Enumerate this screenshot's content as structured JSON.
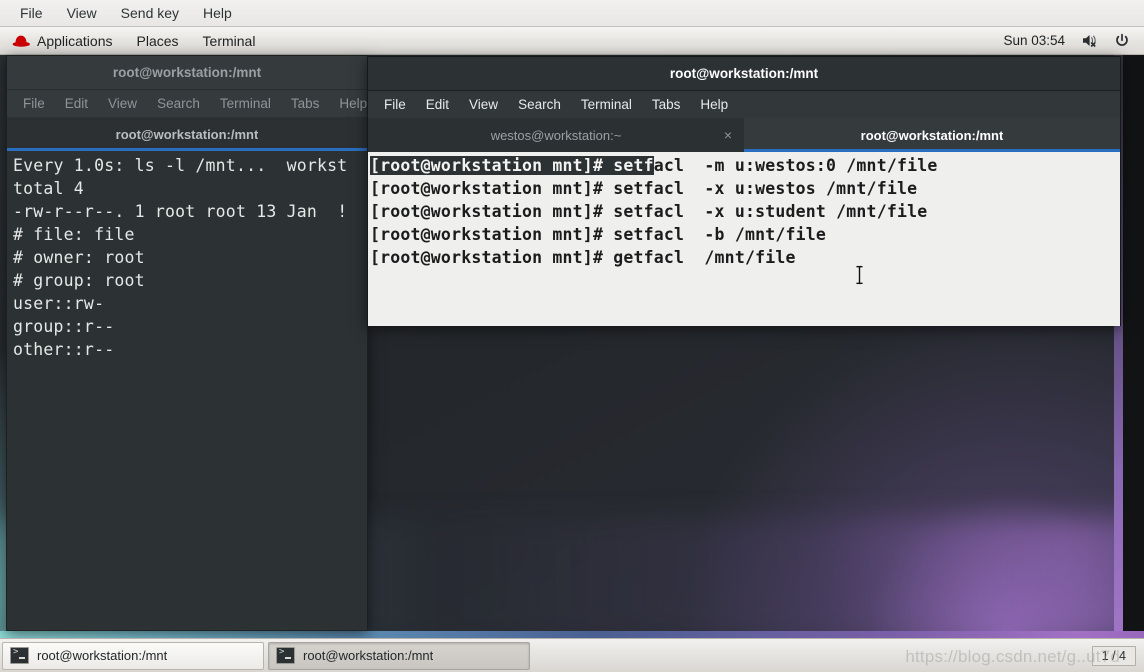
{
  "vm_menu": {
    "items": [
      "File",
      "View",
      "Send key",
      "Help"
    ]
  },
  "gnome_panel": {
    "logo": "redhat-icon",
    "items": [
      "Applications",
      "Places",
      "Terminal"
    ],
    "clock": "Sun 03:54",
    "volume_icon": "volume-muted-icon",
    "power_icon": "power-icon"
  },
  "background_window": {
    "title": "root@workstation:/mnt",
    "menu": [
      "File",
      "Edit",
      "View",
      "Search",
      "Terminal",
      "Tabs",
      "Help"
    ],
    "tabs": [
      {
        "label": "root@workstation:/mnt",
        "active": true
      }
    ],
    "lines": [
      "Every 1.0s: ls -l /mnt...  workst",
      "",
      "total 4",
      "-rw-r--r--. 1 root root 13 Jan  !",
      "# file: file",
      "# owner: root",
      "# group: root",
      "user::rw-",
      "group::r--",
      "other::r--"
    ]
  },
  "foreground_window": {
    "title": "root@workstation:/mnt",
    "menu": [
      "File",
      "Edit",
      "View",
      "Search",
      "Terminal",
      "Tabs",
      "Help"
    ],
    "tabs": [
      {
        "label": "westos@workstation:~",
        "active": false,
        "close": "×"
      },
      {
        "label": "root@workstation:/mnt",
        "active": true
      }
    ],
    "lines": [
      {
        "selected": "[root@workstation mnt]# setf",
        "rest": "acl  -m u:westos:0 /mnt/file"
      },
      {
        "selected": "",
        "rest": "[root@workstation mnt]# setfacl  -x u:westos /mnt/file"
      },
      {
        "selected": "",
        "rest": "[root@workstation mnt]# setfacl  -x u:student /mnt/file"
      },
      {
        "selected": "",
        "rest": "[root@workstation mnt]# setfacl  -b /mnt/file"
      },
      {
        "selected": "",
        "rest": "[root@workstation mnt]# getfacl  /mnt/file"
      }
    ]
  },
  "taskbar": {
    "buttons": [
      {
        "label": "root@workstation:/mnt",
        "pressed": false,
        "icon": "terminal-icon"
      },
      {
        "label": "root@workstation:/mnt",
        "pressed": true,
        "icon": "terminal-icon"
      }
    ],
    "workspace": "1 / 4"
  },
  "watermark": "https://blog.csdn.net/g..ut7d",
  "colors": {
    "accent_blue": "#2a6ec0",
    "terminal_dark_bg": "#2c3134",
    "terminal_light_bg": "#efefed",
    "panel_bg": "#e6e4e1"
  }
}
